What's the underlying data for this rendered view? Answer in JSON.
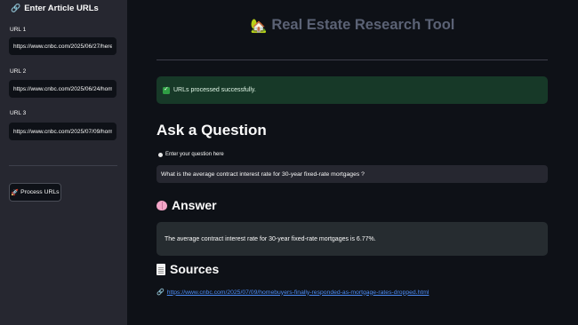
{
  "sidebar": {
    "header": "Enter Article URLs",
    "header_icon": "link-icon",
    "urls": [
      {
        "label": "URL 1",
        "value": "https://www.cnbc.com/2025/06/27/here"
      },
      {
        "label": "URL 2",
        "value": "https://www.cnbc.com/2025/06/24/hom"
      },
      {
        "label": "URL 3",
        "value": "https://www.cnbc.com/2025/07/09/hom"
      }
    ],
    "process_button": "Process URLs",
    "process_icon": "rocket-icon"
  },
  "main": {
    "title": "Real Estate Research Tool",
    "title_icon": "house-icon",
    "success_message": "URLs processed successfully.",
    "ask_heading": "Ask a Question",
    "question_label": "Enter your question here",
    "question_value": "What is the average contract interest rate for 30-year fixed-rate mortgages ?",
    "answer_heading": "Answer",
    "answer_text": "The average contract interest rate for 30-year fixed-rate mortgages is 6.77%.",
    "sources_heading": "Sources",
    "source_link": "https://www.cnbc.com/2025/07/09/homebuyers-finally-responded-as-mortgage-rates-dropped.html"
  },
  "colors": {
    "background": "#0e1117",
    "sidebar": "#262730",
    "success_bg": "#173928",
    "link": "#4d8ef7",
    "title": "#5b6275"
  }
}
